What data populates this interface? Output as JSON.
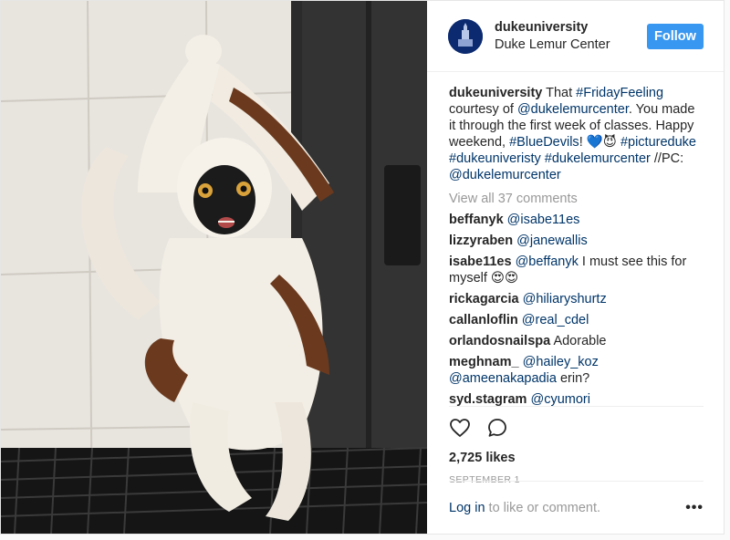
{
  "header": {
    "username": "dukeuniversity",
    "location": "Duke Lemur Center",
    "follow_label": "Follow"
  },
  "caption": {
    "username": "dukeuniversity",
    "text_1": " That ",
    "tag_friday": "#FridayFeeling",
    "text_2": " courtesy of ",
    "tag_lemurcenter": "@dukelemurcenter",
    "text_3": ". You made it through the first week of classes. Happy weekend, ",
    "tag_bluedevils": "#BlueDevils",
    "text_4": "! 💙😈 ",
    "tag_pictureduke": "#pictureduke",
    "tag_dukeuniveristy": "#dukeuniveristy",
    "tag_dukelemurcenter": "#dukelemurcenter",
    "text_5": " //PC: ",
    "tag_pc": "@dukelemurcenter"
  },
  "view_all": "View all 37 comments",
  "comments": [
    {
      "user": "beffanyk",
      "mention": "@isabe11es",
      "text": ""
    },
    {
      "user": "lizzyraben",
      "mention": "@janewallis",
      "text": ""
    },
    {
      "user": "isabe11es",
      "mention": "@beffanyk",
      "text": " I must see this for myself 😍😍"
    },
    {
      "user": "rickagarcia",
      "mention": "@hiliaryshurtz",
      "text": ""
    },
    {
      "user": "callanloflin",
      "mention": "@real_cdel",
      "text": ""
    },
    {
      "user": "orlandosnailspa",
      "mention": "",
      "text": "Adorable"
    },
    {
      "user": "meghnam_",
      "mention": "@hailey_koz @ameenakapadia",
      "text": " erin?"
    },
    {
      "user": "syd.stagram",
      "mention": "@cyumori",
      "text": ""
    }
  ],
  "icons": {
    "like": "heart-icon",
    "comment": "speech-bubble-icon",
    "more": "ellipsis-icon"
  },
  "likes": "2,725 likes",
  "date": "SEPTEMBER 1",
  "login": {
    "link": "Log in",
    "rest": " to like or comment.",
    "more": "•••"
  },
  "colors": {
    "follow": "#3897f0",
    "link": "#003569",
    "muted": "#999999",
    "avatar": "#0b2a6f"
  }
}
